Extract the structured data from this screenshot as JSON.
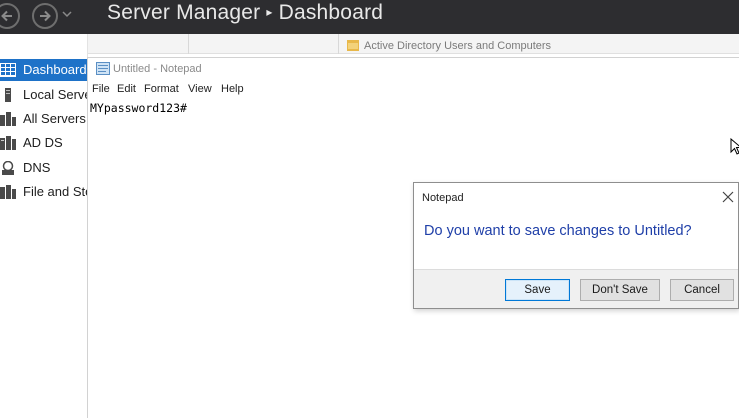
{
  "server_manager": {
    "title": "Server Manager",
    "separator": "▸",
    "page": "Dashboard",
    "nav_items": [
      {
        "label": "Dashboard",
        "icon": "dashboard-grid-icon",
        "active": true
      },
      {
        "label": "Local Server",
        "icon": "local-server-icon",
        "active": false
      },
      {
        "label": "All Servers",
        "icon": "all-servers-icon",
        "active": false
      },
      {
        "label": "AD DS",
        "icon": "ad-ds-icon",
        "active": false
      },
      {
        "label": "DNS",
        "icon": "dns-icon",
        "active": false
      },
      {
        "label": "File and Storage Services",
        "icon": "file-storage-icon",
        "active": false
      }
    ]
  },
  "background_window": {
    "title": "Active Directory Users and Computers"
  },
  "notepad": {
    "title": "Untitled - Notepad",
    "menu": [
      "File",
      "Edit",
      "Format",
      "View",
      "Help"
    ],
    "content": "MYpassword123#"
  },
  "dialog": {
    "title": "Notepad",
    "message": "Do you want to save changes to Untitled?",
    "buttons": {
      "save": "Save",
      "dont_save": "Don't Save",
      "cancel": "Cancel"
    }
  },
  "colors": {
    "header_bg": "#2d2d30",
    "nav_active": "#1e72c8",
    "dialog_message": "#1f3fa8",
    "default_button_border": "#0078d7"
  }
}
